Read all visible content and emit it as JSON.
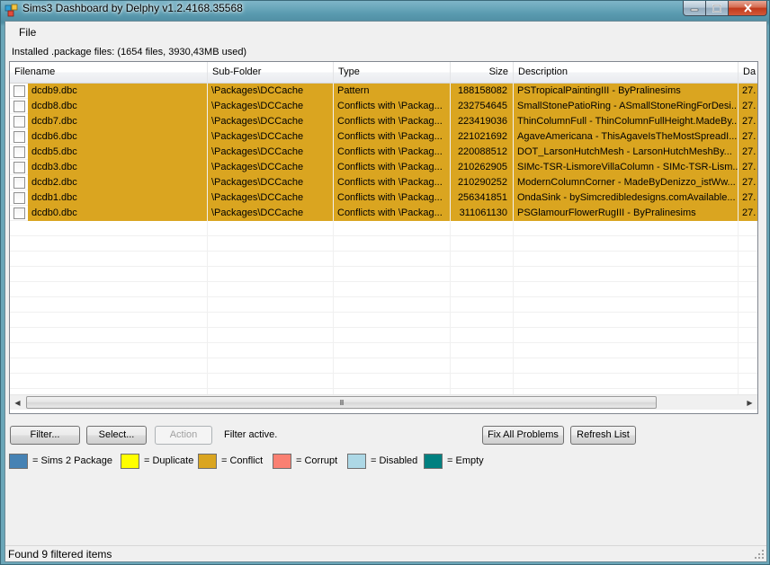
{
  "window": {
    "title": "Sims3 Dashboard by Delphy v1.2.4168.35568",
    "controls": [
      "minimize-icon",
      "maximize-icon",
      "close-icon"
    ]
  },
  "menu": {
    "file": "File"
  },
  "installed_label": "Installed .package files: (1654 files, 3930,43MB used)",
  "table": {
    "columns": [
      "Filename",
      "Sub-Folder",
      "Type",
      "Size",
      "Description",
      "Da"
    ],
    "rows": [
      {
        "filename": "dcdb9.dbc",
        "subfolder": "\\Packages\\DCCache",
        "type": "Pattern",
        "size": "188158082",
        "description": "PSTropicalPaintingIII - ByPralinesims",
        "date": "27."
      },
      {
        "filename": "dcdb8.dbc",
        "subfolder": "\\Packages\\DCCache",
        "type": "Conflicts with \\Packag...",
        "size": "232754645",
        "description": "SmallStonePatioRing - ASmallStoneRingForDesi...",
        "date": "27."
      },
      {
        "filename": "dcdb7.dbc",
        "subfolder": "\\Packages\\DCCache",
        "type": "Conflicts with \\Packag...",
        "size": "223419036",
        "description": "ThinColumnFull - ThinColumnFullHeight.MadeBy...",
        "date": "27."
      },
      {
        "filename": "dcdb6.dbc",
        "subfolder": "\\Packages\\DCCache",
        "type": "Conflicts with \\Packag...",
        "size": "221021692",
        "description": "AgaveAmericana - ThisAgaveIsTheMostSpreadI...",
        "date": "27."
      },
      {
        "filename": "dcdb5.dbc",
        "subfolder": "\\Packages\\DCCache",
        "type": "Conflicts with \\Packag...",
        "size": "220088512",
        "description": "DOT_LarsonHutchMesh - LarsonHutchMeshBy...",
        "date": "27."
      },
      {
        "filename": "dcdb3.dbc",
        "subfolder": "\\Packages\\DCCache",
        "type": "Conflicts with \\Packag...",
        "size": "210262905",
        "description": "SIMc-TSR-LismoreVillaColumn - SIMc-TSR-Lism...",
        "date": "27."
      },
      {
        "filename": "dcdb2.dbc",
        "subfolder": "\\Packages\\DCCache",
        "type": "Conflicts with \\Packag...",
        "size": "210290252",
        "description": "ModernColumnCorner - MadeByDenizzo_istWw...",
        "date": "27."
      },
      {
        "filename": "dcdb1.dbc",
        "subfolder": "\\Packages\\DCCache",
        "type": "Conflicts with \\Packag...",
        "size": "256341851",
        "description": "OndaSink - bySimcredibledesigns.comAvailable...",
        "date": "27."
      },
      {
        "filename": "dcdb0.dbc",
        "subfolder": "\\Packages\\DCCache",
        "type": "Conflicts with \\Packag...",
        "size": "311061130",
        "description": "PSGlamourFlowerRugIII - ByPralinesims",
        "date": "27."
      }
    ],
    "checked": [
      false,
      false,
      false,
      false,
      false,
      false,
      false,
      false,
      false
    ],
    "row_highlight_color": "#daa520",
    "scrollbar_thumb_glyph": "III"
  },
  "buttons": {
    "filter": "Filter...",
    "select": "Select...",
    "action": "Action",
    "fix_all": "Fix All Problems",
    "refresh": "Refresh List"
  },
  "filter_status": "Filter active.",
  "legend": [
    {
      "color": "#4682b4",
      "label": "= Sims 2 Package"
    },
    {
      "color": "#ffff00",
      "label": "= Duplicate"
    },
    {
      "color": "#daa520",
      "label": "= Conflict"
    },
    {
      "color": "#fa8072",
      "label": "= Corrupt"
    },
    {
      "color": "#add8e6",
      "label": "= Disabled"
    },
    {
      "color": "#008080",
      "label": "= Empty"
    }
  ],
  "status": "Found 9 filtered items"
}
